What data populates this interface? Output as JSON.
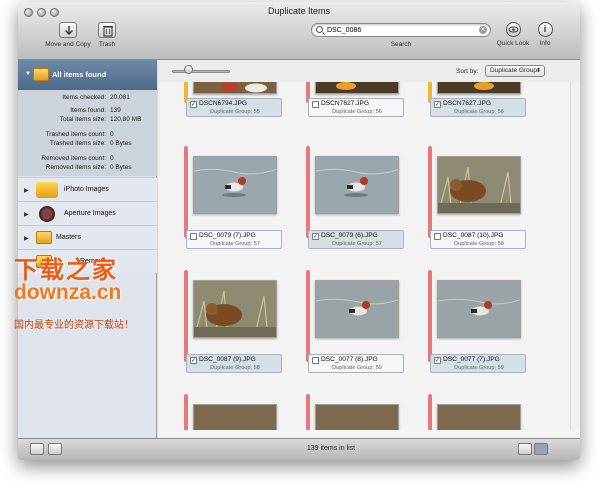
{
  "window": {
    "title": "Duplicate Items"
  },
  "toolbar": {
    "move_copy_label": "Move and Copy",
    "trash_label": "Trash",
    "search_value": "DSC_0086",
    "search_label": "Search",
    "quick_look_label": "Quick Look",
    "info_label": "Info"
  },
  "sidebar": {
    "header_label": "All items found",
    "stats": [
      {
        "key": "Items checked:",
        "value": "20.081"
      },
      {
        "key": "Items found:",
        "value": "139"
      },
      {
        "key": "Total items size:",
        "value": "120,80 MB"
      },
      {
        "key": "Trashed items count:",
        "value": "0"
      },
      {
        "key": "Trashed items size:",
        "value": "0 Bytes"
      },
      {
        "key": "Removed items count:",
        "value": "0"
      },
      {
        "key": "Removed items size:",
        "value": "0 Bytes"
      }
    ],
    "sources": [
      {
        "label": "iPhoto Images"
      },
      {
        "label": "Aperture Images"
      },
      {
        "label": "Masters"
      },
      {
        "label": "Remove"
      }
    ]
  },
  "main": {
    "sort_label": "Sort by:",
    "sort_value": "Duplicate Group",
    "items": [
      {
        "filename": "DSCN6794.JPG",
        "group": "Duplicate Group: 55",
        "checked": true
      },
      {
        "filename": "DSCN7627.JPG",
        "group": "Duplicate Group: 56",
        "checked": false
      },
      {
        "filename": "DSCN7627.JPG",
        "group": "Duplicate Group: 56",
        "checked": true
      },
      {
        "filename": "DSC_0079 (7).JPG",
        "group": "Duplicate Group: 57",
        "checked": false
      },
      {
        "filename": "DSC_0079 (6).JPG",
        "group": "Duplicate Group: 57",
        "checked": true
      },
      {
        "filename": "DSC_0087 (10).JPG",
        "group": "Duplicate Group: 58",
        "checked": false
      },
      {
        "filename": "DSC_0087 (9).JPG",
        "group": "Duplicate Group: 58",
        "checked": true
      },
      {
        "filename": "DSC_0077 (8).JPG",
        "group": "Duplicate Group: 59",
        "checked": false
      },
      {
        "filename": "DSC_0077 (7).JPG",
        "group": "Duplicate Group: 59",
        "checked": true
      }
    ]
  },
  "status": {
    "items_count": "139 items in list"
  },
  "watermark": {
    "cn": "下载之家",
    "en": "downza.cn",
    "sub": "国内最专业的资源下载站！"
  },
  "colors": {
    "accent": "#4c6988",
    "group_red": "#e8787a",
    "group_yellow": "#f0b731",
    "selected_caption": "#d6dee6"
  }
}
